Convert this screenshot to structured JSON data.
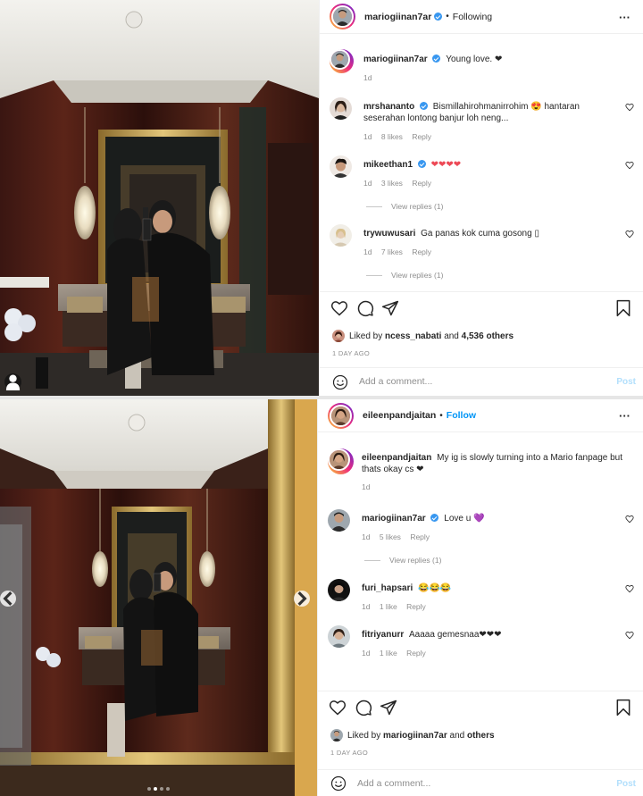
{
  "colors": {
    "link_blue": "#0095f6",
    "verified": "#3897f0",
    "heart_red": "#ed4956",
    "muted": "#8e8e8e"
  },
  "post1": {
    "username": "mariogiinan7ar",
    "follow_status": "Following",
    "caption": {
      "username": "mariogiinan7ar",
      "text": "Young love. ❤",
      "time": "1d"
    },
    "comments": [
      {
        "username": "mrshananto",
        "verified": true,
        "text": "Bismillahirohmanirrohim 😍 hantaran seserahan lontong banjur loh neng...",
        "time": "1d",
        "likes": "8 likes",
        "reply": "Reply"
      },
      {
        "username": "mikeethan1",
        "verified": true,
        "text": "❤❤❤❤",
        "time": "1d",
        "likes": "3 likes",
        "reply": "Reply",
        "view_replies": "View replies (1)"
      },
      {
        "username": "trywuwusari",
        "verified": false,
        "text": "Ga panas kok cuma gosong ▯",
        "time": "1d",
        "likes": "7 likes",
        "reply": "Reply",
        "view_replies": "View replies (1)"
      }
    ],
    "liked_by": {
      "prefix": "Liked by",
      "user": "ncess_nabati",
      "middle": "and",
      "count": "4,536 others"
    },
    "date": "1 DAY AGO",
    "add_comment_placeholder": "Add a comment...",
    "post_button": "Post"
  },
  "post2": {
    "username": "eileenpandjaitan",
    "follow_status": "Follow",
    "caption": {
      "username": "eileenpandjaitan",
      "text": "My ig is slowly turning into a Mario fanpage but thats okay cs ❤",
      "time": "1d"
    },
    "comments": [
      {
        "username": "mariogiinan7ar",
        "verified": true,
        "text": "Love u 💜",
        "time": "1d",
        "likes": "5 likes",
        "reply": "Reply",
        "view_replies": "View replies (1)"
      },
      {
        "username": "furi_hapsari",
        "verified": false,
        "text": "😂😂😂",
        "time": "1d",
        "likes": "1 like",
        "reply": "Reply"
      },
      {
        "username": "fitriyanurr",
        "verified": false,
        "text": "Aaaaa gemesnaa❤❤❤",
        "time": "1d",
        "likes": "1 like",
        "reply": "Reply"
      }
    ],
    "liked_by": {
      "prefix": "Liked by",
      "user": "mariogiinan7ar",
      "middle": "and",
      "count": "others"
    },
    "date": "1 DAY AGO",
    "add_comment_placeholder": "Add a comment...",
    "post_button": "Post",
    "carousel": {
      "total_slides": 4,
      "active_slide": 2
    }
  },
  "icons": [
    "heart-icon",
    "comment-icon",
    "share-icon",
    "bookmark-icon",
    "emoji-icon",
    "more-icon",
    "verified-icon",
    "user-tag-icon",
    "chevron-left-icon",
    "chevron-right-icon"
  ]
}
